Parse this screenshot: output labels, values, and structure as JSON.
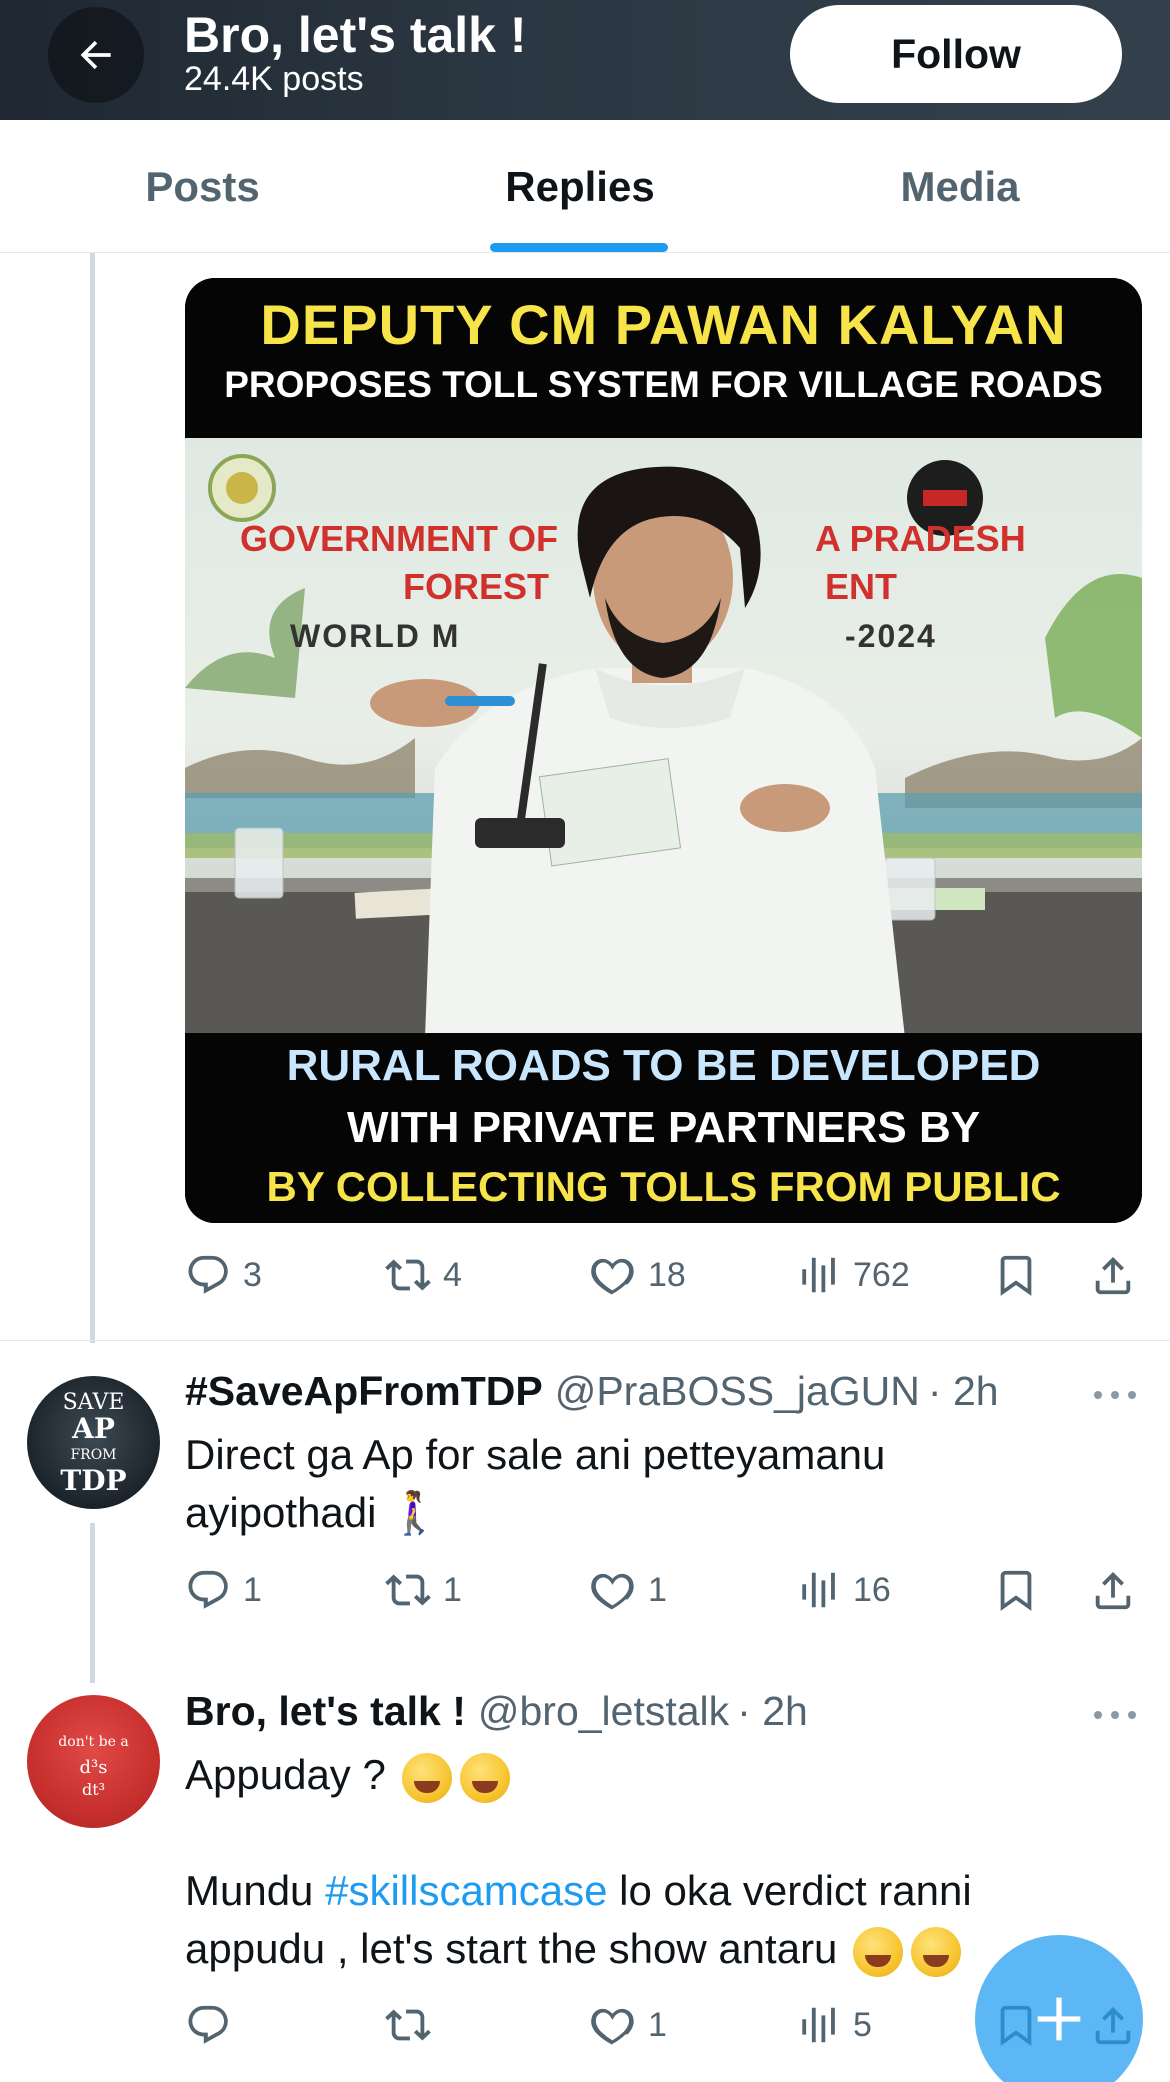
{
  "header": {
    "title": "Bro, let's talk !",
    "post_count": "24.4K posts",
    "follow_label": "Follow"
  },
  "tabs": [
    {
      "label": "Posts",
      "active": false
    },
    {
      "label": "Replies",
      "active": true
    },
    {
      "label": "Media",
      "active": false
    }
  ],
  "accent_color": "#1d9bf0",
  "post": {
    "media": {
      "headline": "DEPUTY CM PAWAN KALYAN",
      "subheadline": "PROPOSES TOLL SYSTEM FOR VILLAGE ROADS",
      "banner_line1": "GOVERNMENT OF",
      "banner_line1b": "A PRADESH",
      "banner_line2": "FOREST",
      "banner_line2b": "ENT",
      "banner_line3": "WORLD M",
      "banner_line3b": "-2024",
      "bottom_line1": "RURAL ROADS TO BE DEVELOPED",
      "bottom_line2": "WITH PRIVATE PARTNERS BY",
      "bottom_line3": "BY COLLECTING TOLLS FROM PUBLIC"
    },
    "stats": {
      "replies": "3",
      "reposts": "4",
      "likes": "18",
      "views": "762"
    }
  },
  "replies": [
    {
      "name": "#SaveApFromTDP",
      "handle": "@PraBOSS_jaGUN",
      "time": "· 2h",
      "avatar_text": [
        "SAVE",
        "AP",
        "FROM",
        "TDP"
      ],
      "text": "Direct ga Ap for sale ani petteyamanu ayipothadi 🚶‍♀️",
      "stats": {
        "replies": "1",
        "reposts": "1",
        "likes": "1",
        "views": "16"
      }
    },
    {
      "name": "Bro, let's talk !",
      "handle": "@bro_letstalk",
      "time": "· 2h",
      "avatar_text": [
        "don't be a",
        "d³s",
        "dt³"
      ],
      "text_line1": "Appuday ?",
      "text_p2_before": "Mundu ",
      "text_p2_hashtag": "#skillscamcase",
      "text_p2_after": " lo oka verdict ranni appudu , let's start the show antaru",
      "stats": {
        "replies": "",
        "reposts": "",
        "likes": "1",
        "views": "5"
      }
    }
  ],
  "icons": {
    "back": "arrow-left-icon",
    "reply": "comment-icon",
    "repost": "repost-icon",
    "like": "heart-icon",
    "views": "analytics-icon",
    "bookmark": "bookmark-icon",
    "share": "share-icon",
    "more": "more-icon",
    "compose": "plus-icon"
  }
}
